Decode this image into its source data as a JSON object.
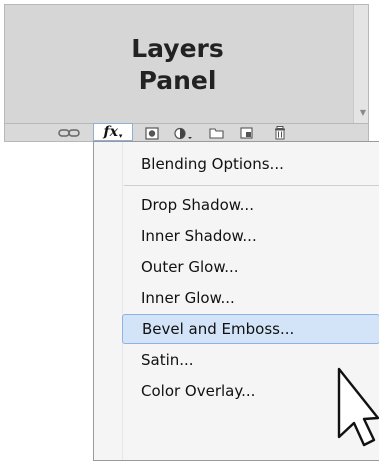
{
  "panel": {
    "title_line1": "Layers",
    "title_line2": "Panel"
  },
  "toolbar": {
    "link_icon": "link-icon",
    "fx_label": "fx",
    "fx_caret": "▾",
    "mask_icon": "layer-mask-icon",
    "adjustment_icon": "adjustment-layer-icon",
    "group_icon": "folder-icon",
    "new_layer_icon": "new-layer-icon",
    "delete_icon": "trash-icon"
  },
  "menu": {
    "items": [
      {
        "label": "Blending Options..."
      },
      {
        "label": "Drop Shadow..."
      },
      {
        "label": "Inner Shadow..."
      },
      {
        "label": "Outer Glow..."
      },
      {
        "label": "Inner Glow..."
      },
      {
        "label": "Bevel and Emboss...",
        "highlighted": true
      },
      {
        "label": "Satin..."
      },
      {
        "label": "Color Overlay..."
      }
    ]
  },
  "colors": {
    "highlight_bg": "#d4e4f8",
    "highlight_border": "#8db2e3",
    "panel_bg": "#d6d6d6"
  }
}
